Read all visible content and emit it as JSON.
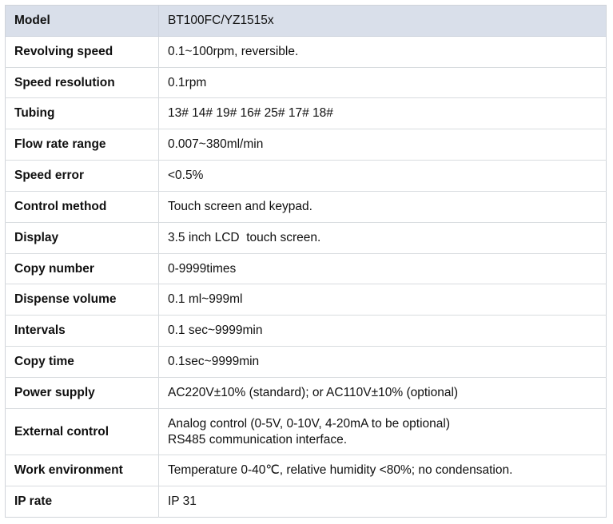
{
  "table": {
    "rows": [
      {
        "label": "Model",
        "value": "BT100FC/YZ1515x",
        "header": true
      },
      {
        "label": "Revolving speed",
        "value": "0.1~100rpm, reversible."
      },
      {
        "label": "Speed resolution",
        "value": "0.1rpm"
      },
      {
        "label": "Tubing",
        "value": "13# 14# 19# 16# 25# 17# 18#"
      },
      {
        "label": "Flow rate range",
        "value": "0.007~380ml/min"
      },
      {
        "label": "Speed error",
        "value": "<0.5%"
      },
      {
        "label": "Control method",
        "value": "Touch screen and keypad."
      },
      {
        "label": "Display",
        "value": "3.5 inch LCD  touch screen."
      },
      {
        "label": "Copy number",
        "value": "0-9999times"
      },
      {
        "label": "Dispense volume",
        "value": "0.1 ml~999ml"
      },
      {
        "label": "Intervals",
        "value": "0.1 sec~9999min"
      },
      {
        "label": "Copy time",
        "value": "0.1sec~9999min"
      },
      {
        "label": "Power supply",
        "value": "AC220V±10% (standard); or AC110V±10% (optional)"
      },
      {
        "label": "External control",
        "value": "Analog control (0-5V, 0-10V, 4-20mA to be optional)\nRS485 communication interface."
      },
      {
        "label": "Work environment",
        "value": "Temperature 0-40℃, relative humidity <80%; no condensation."
      },
      {
        "label": "IP rate",
        "value": "IP 31"
      }
    ]
  },
  "colors": {
    "header_background": "#d9dfea",
    "border": "#d8dcdf",
    "text": "#101010"
  }
}
